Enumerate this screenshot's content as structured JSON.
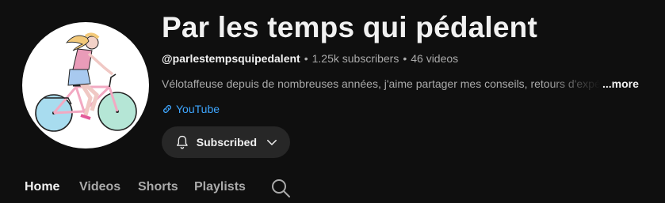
{
  "channel": {
    "name": "Par les temps qui pédalent",
    "handle": "@parlestempsquipedalent",
    "separator": "•",
    "subscribers": "1.25k subscribers",
    "videos": "46 videos",
    "description": "Vélotaffeuse depuis de nombreuses années, j'aime partager mes conseils, retours d'expérience",
    "more_label": "...more",
    "link_label": "YouTube"
  },
  "subscribe": {
    "label": "Subscribed"
  },
  "tabs": [
    {
      "label": "Home"
    },
    {
      "label": "Videos"
    },
    {
      "label": "Shorts"
    },
    {
      "label": "Playlists"
    }
  ],
  "colors": {
    "background": "#0f0f0f",
    "text_primary": "#f1f1f1",
    "text_secondary": "#aaaaaa",
    "link": "#3ea6ff",
    "button_bg": "#272727"
  },
  "icons": {
    "avatar": "cyclist-illustration",
    "link": "link-icon",
    "bell": "bell-icon",
    "chevron": "chevron-down-icon",
    "search": "search-icon"
  }
}
